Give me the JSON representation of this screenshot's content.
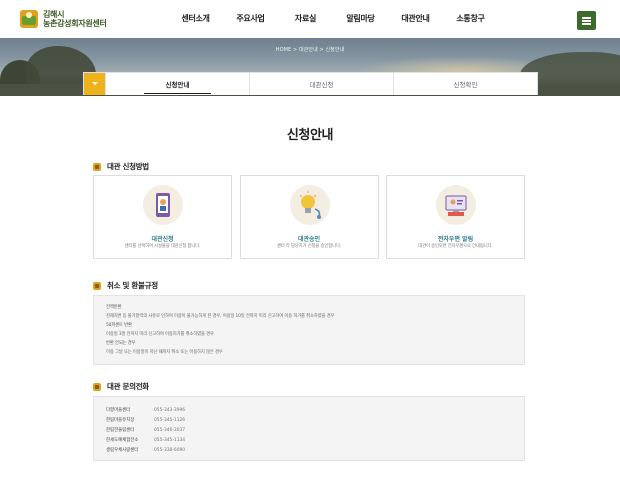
{
  "header": {
    "logo_line1": "김해시",
    "logo_line2": "농촌감성회자원센터",
    "nav": [
      "센터소개",
      "주요사업",
      "자료실",
      "알림마당",
      "대관안내",
      "소통창구"
    ]
  },
  "visual": {
    "breadcrumb": [
      "HOME",
      "대관안내",
      "신청안내"
    ]
  },
  "tabs": {
    "items": [
      "신청안내",
      "대관신청",
      "신청확인"
    ],
    "active": "신청안내"
  },
  "page_title": "신청안내",
  "section_method": {
    "title": "대관 신청방법",
    "cards": [
      {
        "icon": "phone-app-icon",
        "title": "대관신청",
        "desc": "센터를 선택하여 시설물을 대관신청 합니다."
      },
      {
        "icon": "lightbulb-approval-icon",
        "title": "대관승인",
        "desc": "센터 각 담당자가 신청을 승인합니다."
      },
      {
        "icon": "computer-notice-icon",
        "title": "전자우편 알림",
        "desc": "대관이 승인되면 전자우편으로 안내됩니다."
      }
    ]
  },
  "section_refund": {
    "title": "취소 및 환불규정",
    "lines": [
      "전액반환",
      "천재지변 등 불가항력의 사유로 인하여 이용이 불가능하게 된 경우, 이용일 10일 전까지 미리 신고하여 이용 허가를 취소하였을 경우",
      "50퍼센트 반환",
      "이용일 3일 전까지 미리 신고하여 이용허가를 취소하였을 경우",
      "반환 안되는 경우",
      "이용 그날 또는 이용일이 지난 때까지 취소 또는 이용하지 않은 경우"
    ]
  },
  "section_contact": {
    "title": "대관 문의전화",
    "rows": [
      {
        "name": "다향마을센터",
        "phone": "055-343-3996"
      },
      {
        "name": "한림마을유치장",
        "phone": "055-345-1126"
      },
      {
        "name": "한림한울림센터",
        "phone": "055-346-3037"
      },
      {
        "name": "한세도예체험전소",
        "phone": "055-345-1134"
      },
      {
        "name": "생림우체사랑센터",
        "phone": "055-338-6090"
      }
    ]
  },
  "colors": {
    "accent": "#efb21a",
    "brand_green": "#3d6b2e",
    "card_title": "#2f7d8a"
  }
}
